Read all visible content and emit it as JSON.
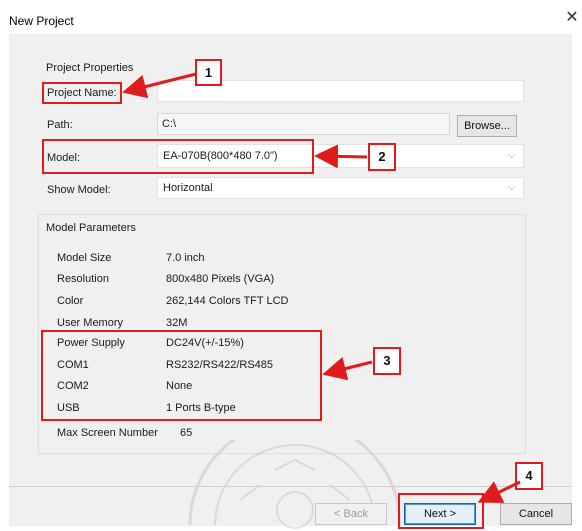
{
  "window": {
    "title": "New Project",
    "close_glyph": "✕"
  },
  "properties": {
    "group_label": "Project Properties",
    "project_name_label": "Project Name:",
    "project_name_value": "",
    "path_label": "Path:",
    "path_value": "C:\\",
    "browse_label": "Browse...",
    "model_label": "Model:",
    "model_value": "EA-070B(800*480  7.0\")",
    "show_model_label": "Show Model:",
    "show_model_value": "Horizontal"
  },
  "parameters": {
    "group_label": "Model Parameters",
    "rows": [
      {
        "label": "Model Size",
        "value": "7.0 inch"
      },
      {
        "label": "Resolution",
        "value": "800x480 Pixels (VGA)"
      },
      {
        "label": "Color",
        "value": "262,144 Colors TFT LCD"
      },
      {
        "label": "User Memory",
        "value": "32M"
      },
      {
        "label": "Power Supply",
        "value": "DC24V(+/-15%)"
      },
      {
        "label": "COM1",
        "value": "RS232/RS422/RS485"
      },
      {
        "label": "COM2",
        "value": "None"
      },
      {
        "label": "USB",
        "value": "1 Ports B-type"
      },
      {
        "label": "Max Screen Number",
        "value": "65"
      }
    ]
  },
  "buttons": {
    "back": "< Back",
    "next": "Next >",
    "cancel": "Cancel"
  },
  "callouts": {
    "c1": "1",
    "c2": "2",
    "c3": "3",
    "c4": "4"
  },
  "colors": {
    "annotation": "#e01b1b",
    "panel": "#f0f0f0",
    "default_button": "#0a64c8"
  }
}
